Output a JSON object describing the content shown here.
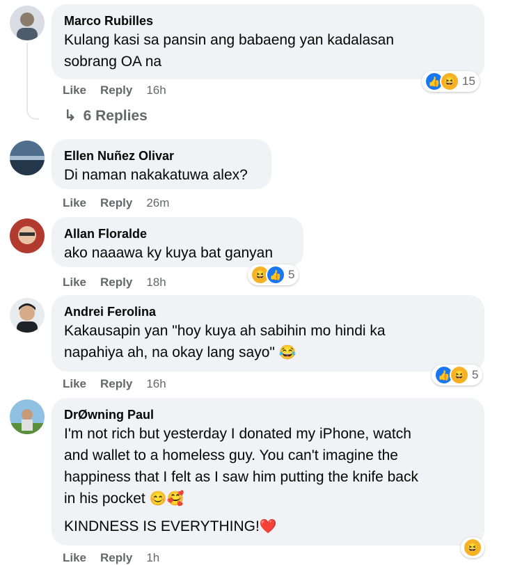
{
  "comments": [
    {
      "author": "Marco Rubilles",
      "text": "Kulang kasi sa pansin ang babaeng yan kadalasan\nsobrang OA na",
      "like": "Like",
      "reply": "Reply",
      "time": "16h",
      "reaction_count": "15",
      "reactions": [
        "like-icon",
        "haha-icon"
      ],
      "replies_label": "6 Replies"
    },
    {
      "author": "Ellen Nuñez Olivar",
      "text": "Di naman nakakatuwa alex?",
      "like": "Like",
      "reply": "Reply",
      "time": "26m"
    },
    {
      "author": "Allan Floralde",
      "text": "ako naaawa ky kuya bat ganyan",
      "like": "Like",
      "reply": "Reply",
      "time": "18h",
      "reaction_count": "5",
      "reactions": [
        "haha-icon",
        "like-icon"
      ]
    },
    {
      "author": "Andrei Ferolina",
      "text": "Kakausapin yan \"hoy kuya ah sabihin mo hindi ka\nnapahiya ah, na okay lang sayo\"",
      "emoji": "😂",
      "like": "Like",
      "reply": "Reply",
      "time": "16h",
      "reaction_count": "5",
      "reactions": [
        "like-icon",
        "haha-icon"
      ]
    },
    {
      "author": "DrØwning Paul",
      "text": "I'm not rich but yesterday I donated my iPhone, watch\nand wallet to a homeless guy. You can't imagine the\nhappiness that I felt as I saw him putting the knife back\nin his pocket",
      "emoji": "😊🥰",
      "text2": "KINDNESS IS EVERYTHING!",
      "emoji2": "❤️",
      "like": "Like",
      "reply": "Reply",
      "time": "1h",
      "reactions": [
        "haha-icon"
      ]
    }
  ],
  "colors": {
    "bubble": "#f0f2f5",
    "muted": "#65676b",
    "like_blue": "#1877f2",
    "haha_yellow": "#f7b125"
  }
}
